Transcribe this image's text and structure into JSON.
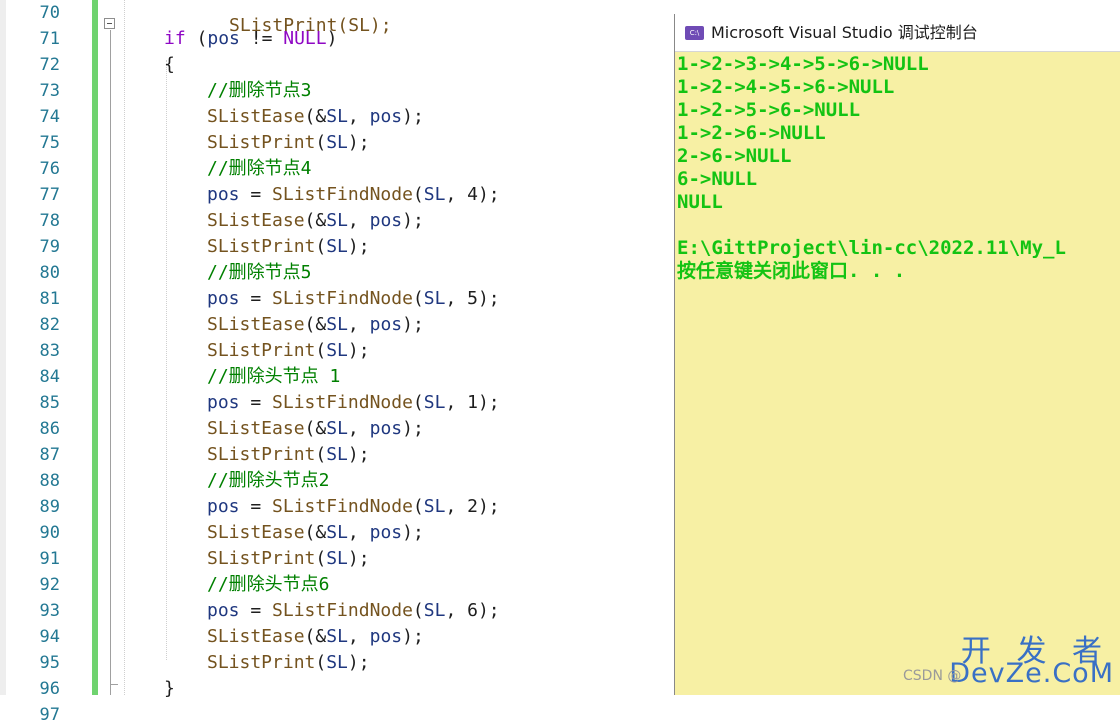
{
  "editor": {
    "top_partial_line": "SListPrint(SL);",
    "lines": [
      {
        "no": "70",
        "indent": 0,
        "tokens": []
      },
      {
        "no": "71",
        "indent": 1,
        "tokens": [
          {
            "t": "if",
            "c": "kw"
          },
          {
            "t": " (",
            "c": "op"
          },
          {
            "t": "pos",
            "c": "var"
          },
          {
            "t": " != ",
            "c": "op"
          },
          {
            "t": "NULL",
            "c": "macro"
          },
          {
            "t": ")",
            "c": "op"
          }
        ]
      },
      {
        "no": "72",
        "indent": 1,
        "tokens": [
          {
            "t": "{",
            "c": "op"
          }
        ]
      },
      {
        "no": "73",
        "indent": 2,
        "tokens": [
          {
            "t": "//删除节点3",
            "c": "cm"
          }
        ]
      },
      {
        "no": "74",
        "indent": 2,
        "tokens": [
          {
            "t": "SListEase",
            "c": "fn"
          },
          {
            "t": "(&",
            "c": "op"
          },
          {
            "t": "SL",
            "c": "var"
          },
          {
            "t": ", ",
            "c": "op"
          },
          {
            "t": "pos",
            "c": "var"
          },
          {
            "t": ");",
            "c": "op"
          }
        ]
      },
      {
        "no": "75",
        "indent": 2,
        "tokens": [
          {
            "t": "SListPrint",
            "c": "fn"
          },
          {
            "t": "(",
            "c": "op"
          },
          {
            "t": "SL",
            "c": "var"
          },
          {
            "t": ");",
            "c": "op"
          }
        ]
      },
      {
        "no": "76",
        "indent": 2,
        "tokens": [
          {
            "t": "//删除节点4",
            "c": "cm"
          }
        ]
      },
      {
        "no": "77",
        "indent": 2,
        "tokens": [
          {
            "t": "pos",
            "c": "var"
          },
          {
            "t": " = ",
            "c": "op"
          },
          {
            "t": "SListFindNode",
            "c": "fn"
          },
          {
            "t": "(",
            "c": "op"
          },
          {
            "t": "SL",
            "c": "var"
          },
          {
            "t": ", 4);",
            "c": "op"
          }
        ]
      },
      {
        "no": "78",
        "indent": 2,
        "tokens": [
          {
            "t": "SListEase",
            "c": "fn"
          },
          {
            "t": "(&",
            "c": "op"
          },
          {
            "t": "SL",
            "c": "var"
          },
          {
            "t": ", ",
            "c": "op"
          },
          {
            "t": "pos",
            "c": "var"
          },
          {
            "t": ");",
            "c": "op"
          }
        ]
      },
      {
        "no": "79",
        "indent": 2,
        "tokens": [
          {
            "t": "SListPrint",
            "c": "fn"
          },
          {
            "t": "(",
            "c": "op"
          },
          {
            "t": "SL",
            "c": "var"
          },
          {
            "t": ");",
            "c": "op"
          }
        ]
      },
      {
        "no": "80",
        "indent": 2,
        "tokens": [
          {
            "t": "//删除节点5",
            "c": "cm"
          }
        ]
      },
      {
        "no": "81",
        "indent": 2,
        "tokens": [
          {
            "t": "pos",
            "c": "var"
          },
          {
            "t": " = ",
            "c": "op"
          },
          {
            "t": "SListFindNode",
            "c": "fn"
          },
          {
            "t": "(",
            "c": "op"
          },
          {
            "t": "SL",
            "c": "var"
          },
          {
            "t": ", 5);",
            "c": "op"
          }
        ]
      },
      {
        "no": "82",
        "indent": 2,
        "tokens": [
          {
            "t": "SListEase",
            "c": "fn"
          },
          {
            "t": "(&",
            "c": "op"
          },
          {
            "t": "SL",
            "c": "var"
          },
          {
            "t": ", ",
            "c": "op"
          },
          {
            "t": "pos",
            "c": "var"
          },
          {
            "t": ");",
            "c": "op"
          }
        ]
      },
      {
        "no": "83",
        "indent": 2,
        "tokens": [
          {
            "t": "SListPrint",
            "c": "fn"
          },
          {
            "t": "(",
            "c": "op"
          },
          {
            "t": "SL",
            "c": "var"
          },
          {
            "t": ");",
            "c": "op"
          }
        ]
      },
      {
        "no": "84",
        "indent": 2,
        "tokens": [
          {
            "t": "//删除头节点 1",
            "c": "cm"
          }
        ]
      },
      {
        "no": "85",
        "indent": 2,
        "tokens": [
          {
            "t": "pos",
            "c": "var"
          },
          {
            "t": " = ",
            "c": "op"
          },
          {
            "t": "SListFindNode",
            "c": "fn"
          },
          {
            "t": "(",
            "c": "op"
          },
          {
            "t": "SL",
            "c": "var"
          },
          {
            "t": ", 1);",
            "c": "op"
          }
        ]
      },
      {
        "no": "86",
        "indent": 2,
        "tokens": [
          {
            "t": "SListEase",
            "c": "fn"
          },
          {
            "t": "(&",
            "c": "op"
          },
          {
            "t": "SL",
            "c": "var"
          },
          {
            "t": ", ",
            "c": "op"
          },
          {
            "t": "pos",
            "c": "var"
          },
          {
            "t": ");",
            "c": "op"
          }
        ]
      },
      {
        "no": "87",
        "indent": 2,
        "tokens": [
          {
            "t": "SListPrint",
            "c": "fn"
          },
          {
            "t": "(",
            "c": "op"
          },
          {
            "t": "SL",
            "c": "var"
          },
          {
            "t": ");",
            "c": "op"
          }
        ]
      },
      {
        "no": "88",
        "indent": 2,
        "tokens": [
          {
            "t": "//删除头节点2",
            "c": "cm"
          }
        ]
      },
      {
        "no": "89",
        "indent": 2,
        "tokens": [
          {
            "t": "pos",
            "c": "var"
          },
          {
            "t": " = ",
            "c": "op"
          },
          {
            "t": "SListFindNode",
            "c": "fn"
          },
          {
            "t": "(",
            "c": "op"
          },
          {
            "t": "SL",
            "c": "var"
          },
          {
            "t": ", 2);",
            "c": "op"
          }
        ]
      },
      {
        "no": "90",
        "indent": 2,
        "tokens": [
          {
            "t": "SListEase",
            "c": "fn"
          },
          {
            "t": "(&",
            "c": "op"
          },
          {
            "t": "SL",
            "c": "var"
          },
          {
            "t": ", ",
            "c": "op"
          },
          {
            "t": "pos",
            "c": "var"
          },
          {
            "t": ");",
            "c": "op"
          }
        ]
      },
      {
        "no": "91",
        "indent": 2,
        "tokens": [
          {
            "t": "SListPrint",
            "c": "fn"
          },
          {
            "t": "(",
            "c": "op"
          },
          {
            "t": "SL",
            "c": "var"
          },
          {
            "t": ");",
            "c": "op"
          }
        ]
      },
      {
        "no": "92",
        "indent": 2,
        "tokens": [
          {
            "t": "//删除头节点6",
            "c": "cm"
          }
        ]
      },
      {
        "no": "93",
        "indent": 2,
        "tokens": [
          {
            "t": "pos",
            "c": "var"
          },
          {
            "t": " = ",
            "c": "op"
          },
          {
            "t": "SListFindNode",
            "c": "fn"
          },
          {
            "t": "(",
            "c": "op"
          },
          {
            "t": "SL",
            "c": "var"
          },
          {
            "t": ", 6);",
            "c": "op"
          }
        ]
      },
      {
        "no": "94",
        "indent": 2,
        "tokens": [
          {
            "t": "SListEase",
            "c": "fn"
          },
          {
            "t": "(&",
            "c": "op"
          },
          {
            "t": "SL",
            "c": "var"
          },
          {
            "t": ", ",
            "c": "op"
          },
          {
            "t": "pos",
            "c": "var"
          },
          {
            "t": ");",
            "c": "op"
          }
        ]
      },
      {
        "no": "95",
        "indent": 2,
        "tokens": [
          {
            "t": "SListPrint",
            "c": "fn"
          },
          {
            "t": "(",
            "c": "op"
          },
          {
            "t": "SL",
            "c": "var"
          },
          {
            "t": ");",
            "c": "op"
          }
        ]
      },
      {
        "no": "96",
        "indent": 1,
        "tokens": [
          {
            "t": "}",
            "c": "op"
          }
        ]
      },
      {
        "no": "97",
        "indent": 0,
        "tokens": []
      }
    ]
  },
  "console": {
    "title": "Microsoft Visual Studio 调试控制台",
    "icon": "console-app-icon",
    "icon_text": "C:\\",
    "output_lines": [
      "1->2->3->4->5->6->NULL",
      "1->2->4->5->6->NULL",
      "1->2->5->6->NULL",
      "1->2->6->NULL",
      "2->6->NULL",
      "6->NULL",
      "NULL",
      "",
      "E:\\GittProject\\lin-cc\\2022.11\\My_L",
      "按任意键关闭此窗口. . ."
    ]
  },
  "watermark": {
    "cn": "开 发 者",
    "en": "DevZe.CoM",
    "csdn": "CSDN @"
  },
  "colors": {
    "console_bg": "#f7f0a4",
    "console_text": "#13c313",
    "change_bar": "#6fd36f",
    "line_number": "#237893"
  }
}
